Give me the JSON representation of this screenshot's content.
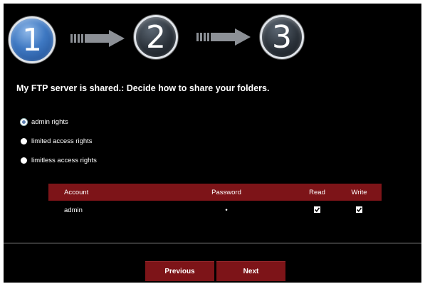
{
  "wizard": {
    "steps": [
      "1",
      "2",
      "3"
    ],
    "current_step": 1
  },
  "heading": "My FTP server is shared.: Decide how to share your folders.",
  "share_options": [
    {
      "label": "admin rights",
      "selected": true
    },
    {
      "label": "limited access rights",
      "selected": false
    },
    {
      "label": "limitless access rights",
      "selected": false
    }
  ],
  "table": {
    "headers": {
      "account": "Account",
      "password": "Password",
      "read": "Read",
      "write": "Write"
    },
    "rows": [
      {
        "account": "admin",
        "password": "•",
        "read": true,
        "write": true
      }
    ]
  },
  "buttons": {
    "previous": "Previous",
    "next": "Next"
  },
  "colors": {
    "accent": "#7d1418",
    "background": "#000000",
    "step_active": "#3e78c2"
  }
}
